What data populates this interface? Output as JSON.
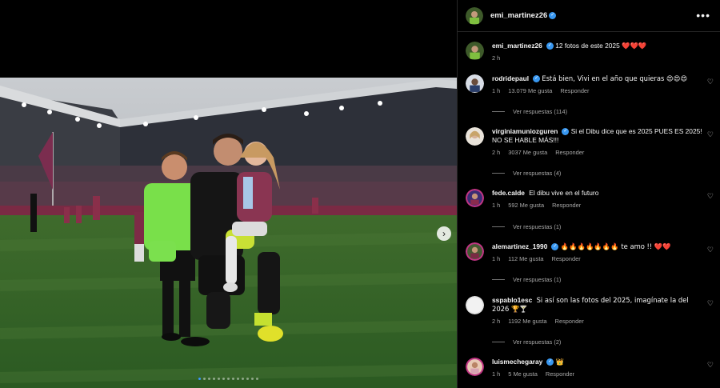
{
  "post": {
    "username": "emi_martinez26",
    "caption": "12 fotos de este 2025",
    "caption_emoji": "❤️❤️❤️",
    "time": "2 h",
    "carousel": {
      "total": 13,
      "current": 1
    }
  },
  "comments": [
    {
      "username": "rodridepaul",
      "verified": true,
      "text": "Está bien, Vivi en el año que quieras 😍😍😍",
      "time": "1 h",
      "likes": "13.079 Me gusta",
      "reply": "Responder",
      "view_replies": "Ver respuestas (114)"
    },
    {
      "username": "virginiamuniozguren",
      "verified": true,
      "text": "Si el Dibu dice que es 2025 PUES ES 2025! NO SE HABLE MÁS!!!",
      "time": "2 h",
      "likes": "3037 Me gusta",
      "reply": "Responder",
      "view_replies": "Ver respuestas (4)"
    },
    {
      "username": "fede.calde",
      "verified": false,
      "text": "El dibu vive en el futuro",
      "time": "1 h",
      "likes": "592 Me gusta",
      "reply": "Responder",
      "view_replies": "Ver respuestas (1)"
    },
    {
      "username": "alemartinez_1990",
      "verified": true,
      "text": "🔥🔥🔥🔥🔥🔥🔥 te amo !! ❤️❤️",
      "time": "1 h",
      "likes": "112 Me gusta",
      "reply": "Responder",
      "view_replies": "Ver respuestas (1)"
    },
    {
      "username": "sspablo1esc",
      "verified": false,
      "text": "Si así son las fotos del 2025, imagínate la del 2026 🏆🍸",
      "time": "2 h",
      "likes": "1192 Me gusta",
      "reply": "Responder",
      "view_replies": "Ver respuestas (2)"
    },
    {
      "username": "luismechegaray",
      "verified": true,
      "text": "👑",
      "time": "1 h",
      "likes": "5 Me gusta",
      "reply": "Responder"
    }
  ],
  "colors": {
    "verified": "#3897f0",
    "accent_dot": "#3a95ff",
    "background": "#000000"
  },
  "icons": {
    "more": "more-horizontal-icon",
    "like": "heart-outline-icon",
    "next": "chevron-right-icon"
  }
}
